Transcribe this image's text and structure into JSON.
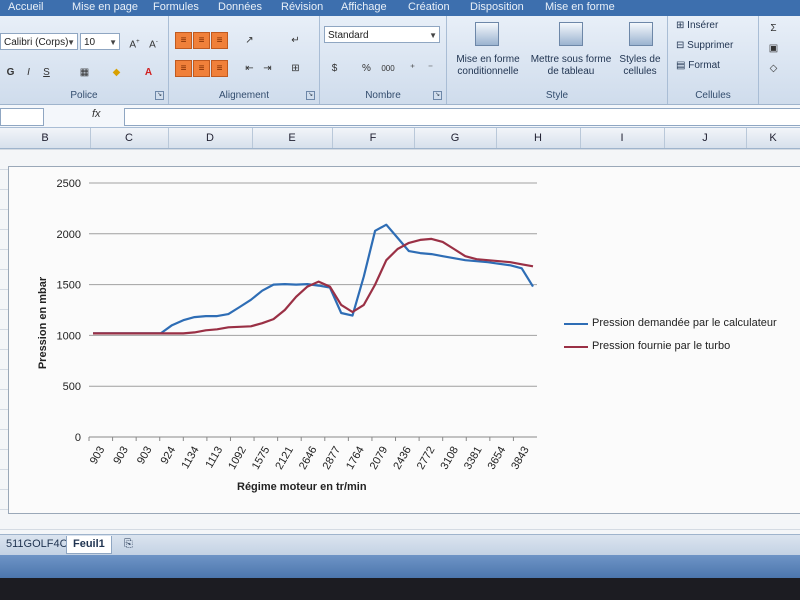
{
  "ribbon_tabs": [
    "Accueil",
    "Mise en page",
    "Formules",
    "Données",
    "Révision",
    "Affichage",
    "Création",
    "Disposition",
    "Mise en forme"
  ],
  "police": {
    "font_name": "Calibri (Corps)",
    "font_size": "10",
    "label": "Police"
  },
  "alignement": {
    "label": "Alignement"
  },
  "nombre": {
    "format": "Standard",
    "percent": "%",
    "thousands": "000",
    "label": "Nombre"
  },
  "style": {
    "cond_format": "Mise en forme conditionnelle",
    "table_format": "Mettre sous forme de tableau",
    "cell_styles": "Styles de cellules",
    "label": "Style"
  },
  "cellules": {
    "insert": "Insérer",
    "delete": "Supprimer",
    "format": "Format",
    "label": "Cellules"
  },
  "formula_bar": {
    "fx": "fx"
  },
  "columns": [
    "B",
    "C",
    "D",
    "E",
    "F",
    "G",
    "H",
    "I",
    "J",
    "K"
  ],
  "chart_data": {
    "type": "line",
    "xlabel": "Régime moteur en tr/min",
    "ylabel": "Pression en mbar",
    "ylim": [
      0,
      2500
    ],
    "yticks": [
      0,
      500,
      1000,
      1500,
      2000,
      2500
    ],
    "categories": [
      "903",
      "903",
      "903",
      "924",
      "1134",
      "1113",
      "1092",
      "1575",
      "2121",
      "2646",
      "2877",
      "1764",
      "2079",
      "2436",
      "2772",
      "3108",
      "3381",
      "3654",
      "3843"
    ],
    "grid": true,
    "legend_position": "right",
    "series": [
      {
        "name": "Pression demandée par le calculateur",
        "color": "#2e6db5",
        "values": [
          1020,
          1020,
          1020,
          1020,
          1020,
          1020,
          1020,
          1100,
          1150,
          1180,
          1190,
          1190,
          1210,
          1280,
          1350,
          1440,
          1500,
          1505,
          1500,
          1505,
          1490,
          1470,
          1220,
          1195,
          1580,
          2030,
          2090,
          1960,
          1830,
          1810,
          1800,
          1780,
          1760,
          1740,
          1730,
          1720,
          1705,
          1690,
          1660,
          1480
        ]
      },
      {
        "name": "Pression fournie par le turbo",
        "color": "#9a3045",
        "values": [
          1020,
          1020,
          1020,
          1020,
          1020,
          1020,
          1020,
          1020,
          1020,
          1030,
          1050,
          1060,
          1080,
          1085,
          1090,
          1120,
          1160,
          1250,
          1380,
          1480,
          1530,
          1480,
          1300,
          1230,
          1300,
          1500,
          1740,
          1850,
          1910,
          1940,
          1950,
          1920,
          1850,
          1780,
          1750,
          1740,
          1730,
          1720,
          1700,
          1680
        ]
      }
    ]
  },
  "sheet_tabs": {
    "first": "511GOLF4C",
    "active": "Feuil1"
  }
}
